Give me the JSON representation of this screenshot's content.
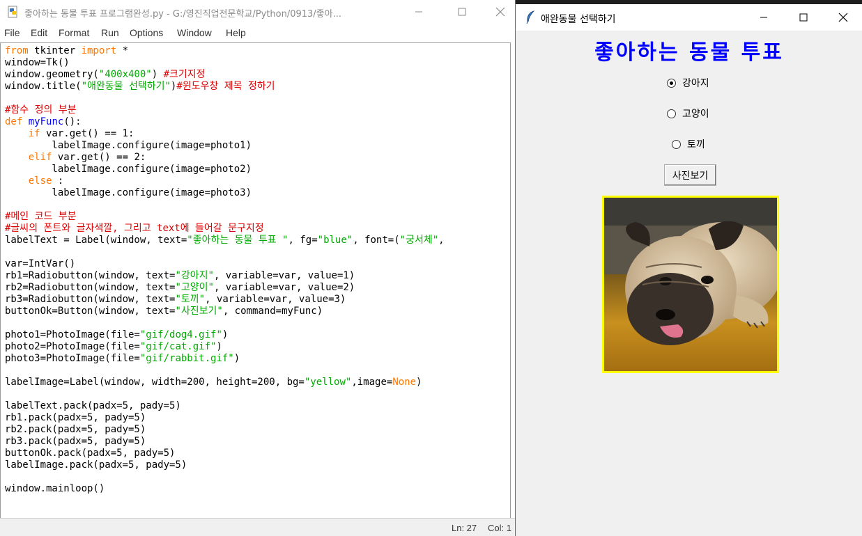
{
  "idle": {
    "title": "좋아하는 동물 투표 프로그램완성.py - G:/영진직업전문학교/Python/0913/좋아...",
    "menu": [
      "File",
      "Edit",
      "Format",
      "Run",
      "Options",
      "Window",
      "Help"
    ],
    "status": {
      "ln": "Ln: 27",
      "col": "Col: 1"
    },
    "code_lines": [
      [
        {
          "t": "from",
          "c": "kw"
        },
        {
          "t": " tkinter "
        },
        {
          "t": "import",
          "c": "kw"
        },
        {
          "t": " *"
        }
      ],
      [
        {
          "t": "window=Tk()"
        }
      ],
      [
        {
          "t": "window.geometry("
        },
        {
          "t": "\"400x400\"",
          "c": "str"
        },
        {
          "t": ") "
        },
        {
          "t": "#크기지정",
          "c": "cmt"
        }
      ],
      [
        {
          "t": "window.title("
        },
        {
          "t": "\"애완동물 선택하기\"",
          "c": "str"
        },
        {
          "t": ")"
        },
        {
          "t": "#윈도우창 제목 정하기",
          "c": "cmt"
        }
      ],
      [
        {
          "t": ""
        }
      ],
      [
        {
          "t": "#함수 정의 부분",
          "c": "cmt"
        }
      ],
      [
        {
          "t": "def",
          "c": "kw"
        },
        {
          "t": " "
        },
        {
          "t": "myFunc",
          "c": "fn"
        },
        {
          "t": "():"
        }
      ],
      [
        {
          "t": "    "
        },
        {
          "t": "if",
          "c": "kw"
        },
        {
          "t": " var.get() == 1:"
        }
      ],
      [
        {
          "t": "        labelImage.configure(image=photo1)"
        }
      ],
      [
        {
          "t": "    "
        },
        {
          "t": "elif",
          "c": "kw"
        },
        {
          "t": " var.get() == 2:"
        }
      ],
      [
        {
          "t": "        labelImage.configure(image=photo2)"
        }
      ],
      [
        {
          "t": "    "
        },
        {
          "t": "else",
          "c": "kw"
        },
        {
          "t": " :"
        }
      ],
      [
        {
          "t": "        labelImage.configure(image=photo3)"
        }
      ],
      [
        {
          "t": ""
        }
      ],
      [
        {
          "t": "#메인 코드 부분",
          "c": "cmt"
        }
      ],
      [
        {
          "t": "#글씨의 폰트와 글자색깔, 그리고 text에 들어갈 문구지정",
          "c": "cmt"
        }
      ],
      [
        {
          "t": "labelText = Label(window, text="
        },
        {
          "t": "\"좋아하는 동물 투표 \"",
          "c": "str"
        },
        {
          "t": ", fg="
        },
        {
          "t": "\"blue\"",
          "c": "str"
        },
        {
          "t": ", font=("
        },
        {
          "t": "\"궁서체\"",
          "c": "str"
        },
        {
          "t": ","
        }
      ],
      [
        {
          "t": ""
        }
      ],
      [
        {
          "t": "var=IntVar()"
        }
      ],
      [
        {
          "t": "rb1=Radiobutton(window, text="
        },
        {
          "t": "\"강아지\"",
          "c": "str"
        },
        {
          "t": ", variable=var, value=1)"
        }
      ],
      [
        {
          "t": "rb2=Radiobutton(window, text="
        },
        {
          "t": "\"고양이\"",
          "c": "str"
        },
        {
          "t": ", variable=var, value=2)"
        }
      ],
      [
        {
          "t": "rb3=Radiobutton(window, text="
        },
        {
          "t": "\"토끼\"",
          "c": "str"
        },
        {
          "t": ", variable=var, value=3)"
        }
      ],
      [
        {
          "t": "buttonOk=Button(window, text="
        },
        {
          "t": "\"사진보기\"",
          "c": "str"
        },
        {
          "t": ", command=myFunc)"
        }
      ],
      [
        {
          "t": ""
        }
      ],
      [
        {
          "t": "photo1=PhotoImage(file="
        },
        {
          "t": "\"gif/dog4.gif\"",
          "c": "str"
        },
        {
          "t": ")"
        }
      ],
      [
        {
          "t": "photo2=PhotoImage(file="
        },
        {
          "t": "\"gif/cat.gif\"",
          "c": "str"
        },
        {
          "t": ")"
        }
      ],
      [
        {
          "t": "photo3=PhotoImage(file="
        },
        {
          "t": "\"gif/rabbit.gif\"",
          "c": "str"
        },
        {
          "t": ")"
        }
      ],
      [
        {
          "t": ""
        }
      ],
      [
        {
          "t": "labelImage=Label(window, width=200, height=200, bg="
        },
        {
          "t": "\"yellow\"",
          "c": "str"
        },
        {
          "t": ",image="
        },
        {
          "t": "None",
          "c": "kw"
        },
        {
          "t": ")"
        }
      ],
      [
        {
          "t": ""
        }
      ],
      [
        {
          "t": "labelText.pack(padx=5, pady=5)"
        }
      ],
      [
        {
          "t": "rb1.pack(padx=5, pady=5)"
        }
      ],
      [
        {
          "t": "rb2.pack(padx=5, pady=5)"
        }
      ],
      [
        {
          "t": "rb3.pack(padx=5, pady=5)"
        }
      ],
      [
        {
          "t": "buttonOk.pack(padx=5, pady=5)"
        }
      ],
      [
        {
          "t": "labelImage.pack(padx=5, pady=5)"
        }
      ],
      [
        {
          "t": ""
        }
      ],
      [
        {
          "t": "window.mainloop()"
        }
      ]
    ]
  },
  "tk": {
    "title": "애완동물 선택하기",
    "heading": "좋아하는 동물 투표",
    "radios": [
      {
        "label": "강아지",
        "selected": true
      },
      {
        "label": "고양이",
        "selected": false
      },
      {
        "label": "토끼",
        "selected": false
      }
    ],
    "button_label": "사진보기",
    "image_bg": "#ffff00",
    "heading_color": "#0000ff"
  }
}
